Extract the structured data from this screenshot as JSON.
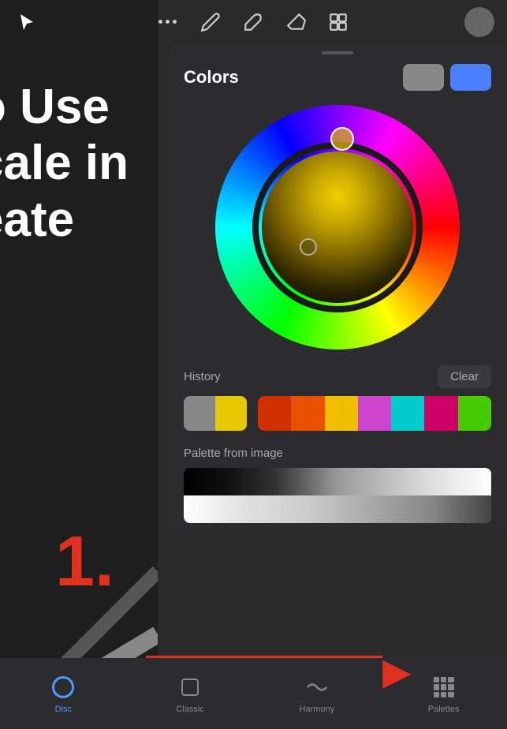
{
  "toolbar": {
    "tools": [
      "cursor",
      "more-options",
      "pencil",
      "brush",
      "eraser",
      "layers"
    ],
    "avatar": "user-avatar"
  },
  "colors_panel": {
    "title": "Colors",
    "preview_colors": [
      "#888888",
      "#4a7fff"
    ],
    "handle": true
  },
  "history": {
    "label": "History",
    "clear_button": "Clear",
    "swatches_left": [
      "#888888",
      "#e8c800"
    ],
    "swatches_right": [
      "#d03000",
      "#e85000",
      "#f0c000",
      "#cc44cc",
      "#00cccc",
      "#cc0066",
      "#44cc00"
    ]
  },
  "palette": {
    "label": "Palette from image"
  },
  "tabs": [
    {
      "id": "disc",
      "label": "Disc",
      "active": true
    },
    {
      "id": "classic",
      "label": "Classic",
      "active": false
    },
    {
      "id": "harmony",
      "label": "Harmony",
      "active": false
    },
    {
      "id": "palettes",
      "label": "Palettes",
      "active": false
    }
  ],
  "canvas": {
    "text_lines": [
      "o Use",
      "cale in",
      "eate"
    ],
    "number": "1."
  }
}
